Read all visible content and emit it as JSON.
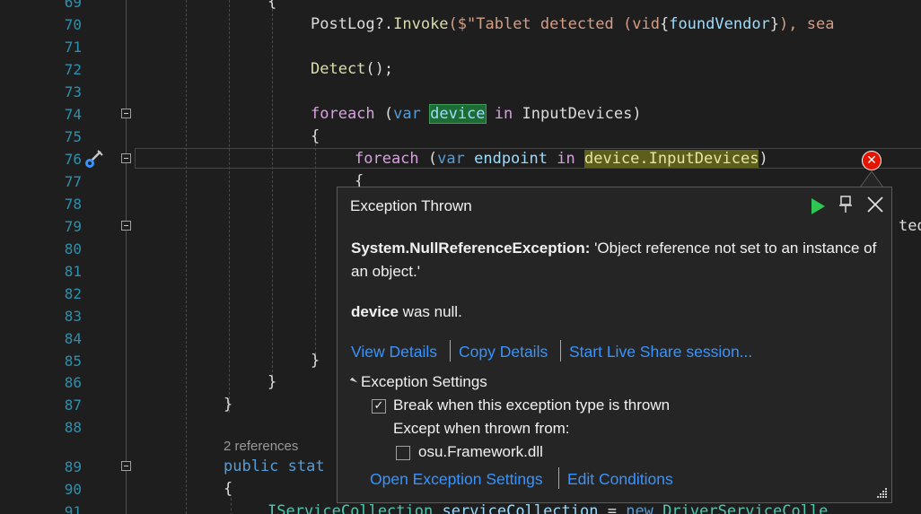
{
  "editor": {
    "lines": [
      {
        "n": "69",
        "tokens": [
          {
            "t": "{",
            "c": ""
          }
        ]
      },
      {
        "n": "70",
        "tokens": [
          {
            "t": "PostLog?.",
            "c": ""
          },
          {
            "t": "Invoke",
            "c": "fn"
          },
          {
            "t": "($\"Tablet detected (vid",
            "c": "str"
          },
          {
            "t": "{",
            "c": ""
          },
          {
            "t": "foundVendor",
            "c": "var"
          },
          {
            "t": "}",
            "c": ""
          },
          {
            "t": "), sea",
            "c": "str"
          }
        ]
      },
      {
        "n": "71",
        "tokens": []
      },
      {
        "n": "72",
        "tokens": [
          {
            "t": "Detect",
            "c": "fn"
          },
          {
            "t": "();",
            "c": ""
          }
        ]
      },
      {
        "n": "73",
        "tokens": []
      },
      {
        "n": "74",
        "tokens": [
          {
            "t": "foreach",
            "c": "kc"
          },
          {
            "t": " (",
            "c": ""
          },
          {
            "t": "var",
            "c": "kw"
          },
          {
            "t": " ",
            "c": ""
          },
          {
            "t": "device",
            "c": "var hl-green"
          },
          {
            "t": " ",
            "c": ""
          },
          {
            "t": "in",
            "c": "kc"
          },
          {
            "t": " InputDevices)",
            "c": ""
          }
        ]
      },
      {
        "n": "75",
        "tokens": [
          {
            "t": "{",
            "c": ""
          }
        ]
      },
      {
        "n": "76",
        "tokens": [
          {
            "t": "foreach",
            "c": "kc"
          },
          {
            "t": " (",
            "c": ""
          },
          {
            "t": "var",
            "c": "kw"
          },
          {
            "t": " ",
            "c": ""
          },
          {
            "t": "endpoint",
            "c": "var"
          },
          {
            "t": " ",
            "c": ""
          },
          {
            "t": "in",
            "c": "kc"
          },
          {
            "t": " ",
            "c": ""
          },
          {
            "t": "device.InputDevices",
            "c": "hl-yellow"
          },
          {
            "t": ")",
            "c": ""
          }
        ]
      },
      {
        "n": "77",
        "tokens": [
          {
            "t": "{",
            "c": ""
          }
        ]
      },
      {
        "n": "78",
        "tokens": []
      },
      {
        "n": "79",
        "tokens": [
          {
            "t": "ted)",
            "c": ""
          }
        ]
      },
      {
        "n": "80",
        "tokens": []
      },
      {
        "n": "81",
        "tokens": []
      },
      {
        "n": "82",
        "tokens": []
      },
      {
        "n": "83",
        "tokens": []
      },
      {
        "n": "84",
        "tokens": []
      },
      {
        "n": "85",
        "tokens": [
          {
            "t": "}",
            "c": ""
          }
        ]
      },
      {
        "n": "86",
        "tokens": [
          {
            "t": "}",
            "c": ""
          }
        ]
      },
      {
        "n": "87",
        "tokens": [
          {
            "t": "}",
            "c": ""
          }
        ]
      },
      {
        "n": "88",
        "tokens": []
      },
      {
        "n": "89",
        "tokens": [
          {
            "t": "public",
            "c": "kw"
          },
          {
            "t": " stat",
            "c": "kw"
          }
        ]
      },
      {
        "n": "90",
        "tokens": [
          {
            "t": "{",
            "c": ""
          }
        ]
      },
      {
        "n": "91",
        "tokens": [
          {
            "t": "IServiceCollection",
            "c": "ty"
          },
          {
            "t": " ",
            "c": ""
          },
          {
            "t": "serviceCollection",
            "c": "var"
          },
          {
            "t": " = ",
            "c": ""
          },
          {
            "t": "new",
            "c": "kw"
          },
          {
            "t": " ",
            "c": ""
          },
          {
            "t": "DriverServiceColle",
            "c": "ty"
          }
        ]
      }
    ],
    "codelens": "2 references"
  },
  "popup": {
    "title": "Exception Thrown",
    "exception_type": "System.NullReferenceException:",
    "exception_message": " 'Object reference not set to an instance of an object.'",
    "null_var": "device",
    "null_suffix": " was null.",
    "links": {
      "view_details": "View Details",
      "copy_details": "Copy Details",
      "live_share": "Start Live Share session..."
    },
    "settings": {
      "header": "Exception Settings",
      "break_label": "Break when this exception type is thrown",
      "break_checked": true,
      "except_label": "Except when thrown from:",
      "module_label": "osu.Framework.dll",
      "module_checked": false,
      "open_settings": "Open Exception Settings",
      "edit_conditions": "Edit Conditions"
    }
  }
}
